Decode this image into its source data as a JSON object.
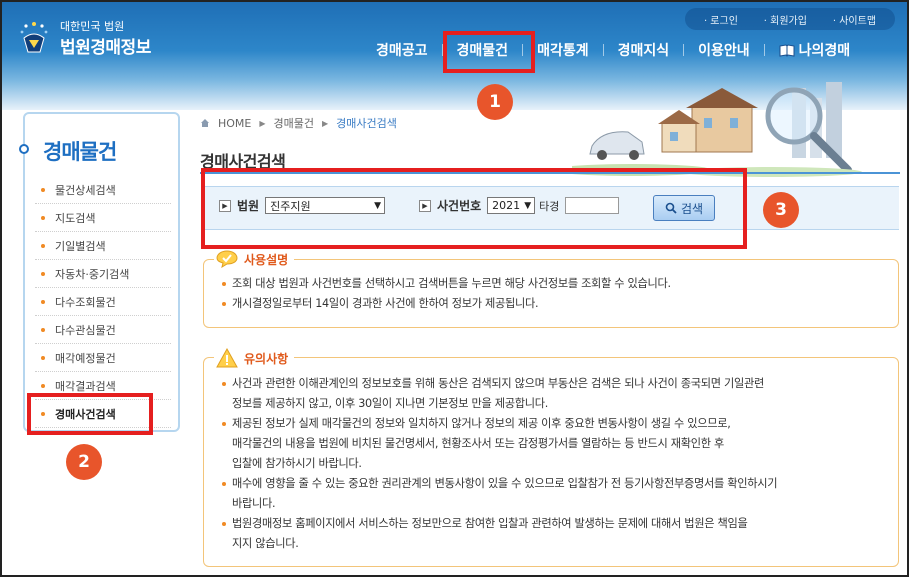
{
  "header": {
    "logo_sub": "대한민국 법원",
    "logo_main": "법원경매정보",
    "util_links": [
      "로그인",
      "회원가입",
      "사이트맵"
    ],
    "nav": [
      "경매공고",
      "경매물건",
      "매각통계",
      "경매지식",
      "이용안내",
      "나의경매"
    ]
  },
  "badges": [
    "1",
    "2",
    "3"
  ],
  "sidebar": {
    "title": "경매물건",
    "items": [
      "물건상세검색",
      "지도검색",
      "기일별검색",
      "자동차·중기검색",
      "다수조회물건",
      "다수관심물건",
      "매각예정물건",
      "매각결과검색",
      "경매사건검색"
    ],
    "active_index": 8
  },
  "breadcrumb": [
    "HOME",
    "경매물건",
    "경매사건검색"
  ],
  "page_title": "경매사건검색",
  "search": {
    "court_label": "법원",
    "court_value": "진주지원",
    "case_label": "사건번호",
    "year_value": "2021",
    "other_label": "타경",
    "case_number_value": "",
    "search_button": "검색"
  },
  "usage": {
    "title": "사용설명",
    "lines": [
      "조회 대상 법원과 사건번호를 선택하시고 검색버튼을 누르면 해당 사건정보를 조회할 수 있습니다.",
      "개시결정일로부터 14일이 경과한 사건에 한하여 정보가 제공됩니다."
    ]
  },
  "caution": {
    "title": "유의사항",
    "lines": [
      [
        "사건과 관련한 이해관계인의 정보보호를 위해 동산은 검색되지 않으며 부동산은 검색은 되나 사건이 종국되면 기일관련",
        "정보를 제공하지 않고, 이후 30일이 지나면 기본정보 만을 제공합니다."
      ],
      [
        "제공된 정보가 실제 매각물건의 정보와 일치하지 않거나 정보의 제공 이후 중요한 변동사항이 생길 수 있으므로,",
        "매각물건의 내용을 법원에 비치된 물건명세서, 현황조사서 또는 감정평가서를 열람하는 등 반드시 재확인한 후",
        "입찰에 참가하시기 바랍니다."
      ],
      [
        "매수에 영향을 줄 수 있는 중요한 권리관계의 변동사항이 있을 수 있으므로 입찰참가 전 등기사항전부증명서를 확인하시기",
        "바랍니다."
      ],
      [
        "법원경매정보 홈페이지에서 서비스하는 정보만으로 참여한 입찰과 관련하여 발생하는 문제에 대해서 법원은 책임을",
        "지지 않습니다."
      ]
    ]
  },
  "colors": {
    "header_blue": "#1f6fb6",
    "accent_blue": "#1e6fc2",
    "annotation_red": "#e51f1f",
    "badge_orange": "#e8552b",
    "box_border": "#f3c57a"
  }
}
